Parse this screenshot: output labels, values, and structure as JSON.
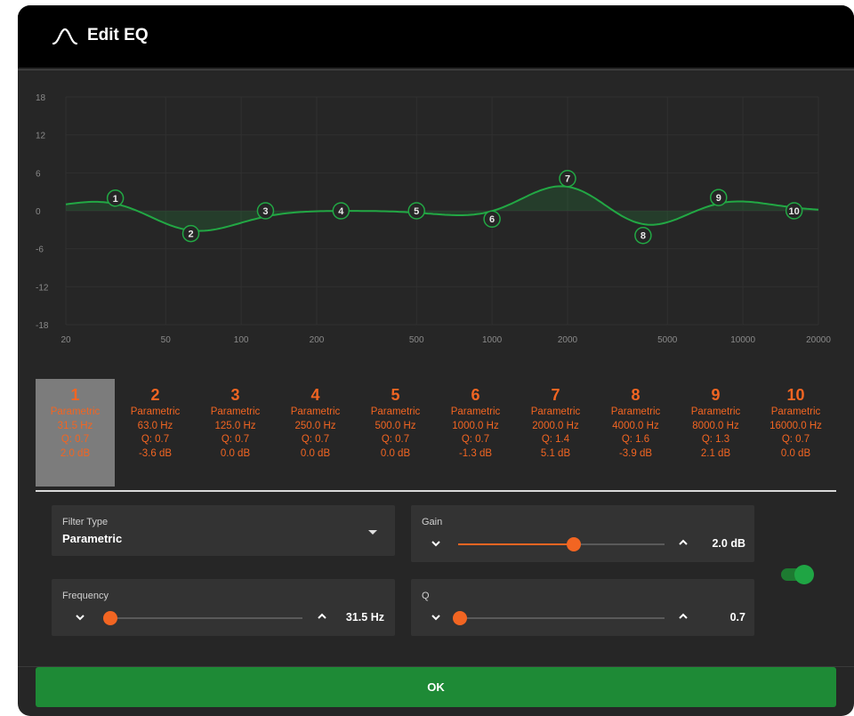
{
  "dialog": {
    "title": "Edit EQ"
  },
  "graph": {
    "y_ticks": [
      "18",
      "12",
      "6",
      "0",
      "-6",
      "-12",
      "-18"
    ],
    "x_ticks": [
      "20",
      "50",
      "100",
      "200",
      "500",
      "1000",
      "2000",
      "5000",
      "10000",
      "20000"
    ],
    "curve_color": "#22a844"
  },
  "chart_data": {
    "type": "line",
    "x_scale": "log",
    "xlim": [
      20,
      20000
    ],
    "ylim": [
      -18,
      18
    ],
    "x_ticks": [
      20,
      50,
      100,
      200,
      500,
      1000,
      2000,
      5000,
      10000,
      20000
    ],
    "y_ticks": [
      18,
      12,
      6,
      0,
      -6,
      -12,
      -18
    ],
    "points": [
      {
        "label": "1",
        "freq": 31.5,
        "gain": 2.0
      },
      {
        "label": "2",
        "freq": 63.0,
        "gain": -3.6
      },
      {
        "label": "3",
        "freq": 125.0,
        "gain": 0.0
      },
      {
        "label": "4",
        "freq": 250.0,
        "gain": 0.0
      },
      {
        "label": "5",
        "freq": 500.0,
        "gain": 0.0
      },
      {
        "label": "6",
        "freq": 1000.0,
        "gain": -1.3
      },
      {
        "label": "7",
        "freq": 2000.0,
        "gain": 5.1
      },
      {
        "label": "8",
        "freq": 4000.0,
        "gain": -3.9
      },
      {
        "label": "9",
        "freq": 8000.0,
        "gain": 2.1
      },
      {
        "label": "10",
        "freq": 16000.0,
        "gain": 0.0
      }
    ]
  },
  "bands": [
    {
      "num": "1",
      "type": "Parametric",
      "freq": "31.5 Hz",
      "q": "Q: 0.7",
      "gain": "2.0 dB"
    },
    {
      "num": "2",
      "type": "Parametric",
      "freq": "63.0 Hz",
      "q": "Q: 0.7",
      "gain": "-3.6 dB"
    },
    {
      "num": "3",
      "type": "Parametric",
      "freq": "125.0 Hz",
      "q": "Q: 0.7",
      "gain": "0.0 dB"
    },
    {
      "num": "4",
      "type": "Parametric",
      "freq": "250.0 Hz",
      "q": "Q: 0.7",
      "gain": "0.0 dB"
    },
    {
      "num": "5",
      "type": "Parametric",
      "freq": "500.0 Hz",
      "q": "Q: 0.7",
      "gain": "0.0 dB"
    },
    {
      "num": "6",
      "type": "Parametric",
      "freq": "1000.0 Hz",
      "q": "Q: 0.7",
      "gain": "-1.3 dB"
    },
    {
      "num": "7",
      "type": "Parametric",
      "freq": "2000.0 Hz",
      "q": "Q: 1.4",
      "gain": "5.1 dB"
    },
    {
      "num": "8",
      "type": "Parametric",
      "freq": "4000.0 Hz",
      "q": "Q: 1.6",
      "gain": "-3.9 dB"
    },
    {
      "num": "9",
      "type": "Parametric",
      "freq": "8000.0 Hz",
      "q": "Q: 1.3",
      "gain": "2.1 dB"
    },
    {
      "num": "10",
      "type": "Parametric",
      "freq": "16000.0 Hz",
      "q": "Q: 0.7",
      "gain": "0.0 dB"
    }
  ],
  "selected_band": 0,
  "controls": {
    "filter_type": {
      "label": "Filter Type",
      "value": "Parametric"
    },
    "gain": {
      "label": "Gain",
      "value": "2.0 dB",
      "fraction": 0.56
    },
    "frequency": {
      "label": "Frequency",
      "value": "31.5 Hz",
      "fraction": 0.0
    },
    "q": {
      "label": "Q",
      "value": "0.7",
      "fraction": 0.0
    },
    "enabled": true
  },
  "ok_label": "OK",
  "colors": {
    "accent": "#f26522",
    "green": "#1e8a36",
    "background": "#262626"
  }
}
